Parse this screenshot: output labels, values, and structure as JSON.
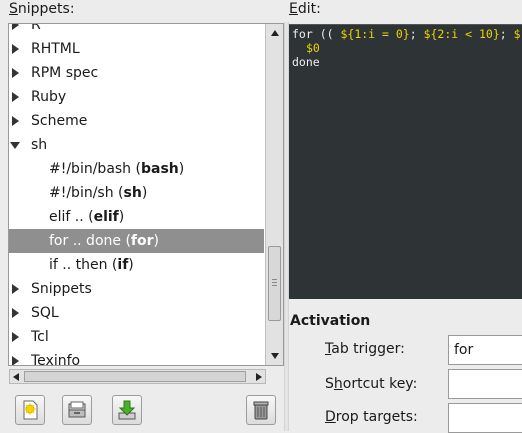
{
  "labels": {
    "snippets_first": "S",
    "snippets_rest": "nippets:",
    "edit_first": "E",
    "edit_rest": "dit:"
  },
  "tree": [
    {
      "label": "R",
      "expanded": false,
      "child": false
    },
    {
      "label": "RHTML",
      "expanded": false,
      "child": false
    },
    {
      "label": "RPM spec",
      "expanded": false,
      "child": false
    },
    {
      "label": "Ruby",
      "expanded": false,
      "child": false
    },
    {
      "label": "Scheme",
      "expanded": false,
      "child": false
    },
    {
      "label": "sh",
      "expanded": true,
      "child": false
    },
    {
      "label": "#!/bin/bash (",
      "trigger": "bash",
      "child": true
    },
    {
      "label": "#!/bin/sh (",
      "trigger": "sh",
      "child": true
    },
    {
      "label": "elif .. (",
      "trigger": "elif",
      "child": true
    },
    {
      "label": "for .. done (",
      "trigger": "for",
      "child": true,
      "selected": true
    },
    {
      "label": "if .. then (",
      "trigger": "if",
      "child": true
    },
    {
      "label": "Snippets",
      "expanded": false,
      "child": false
    },
    {
      "label": "SQL",
      "expanded": false,
      "child": false
    },
    {
      "label": "Tcl",
      "expanded": false,
      "child": false
    },
    {
      "label": "Texinfo",
      "expanded": false,
      "child": false
    }
  ],
  "editor": {
    "line1_a": "for (( ",
    "line1_ph1": "${1:i = 0}",
    "line1_b": "; ",
    "line1_ph2": "${2:i < 10}",
    "line1_c": "; ",
    "line1_ph3": "$",
    "line2": "$0",
    "line3": "done"
  },
  "activation": {
    "title": "Activation",
    "tab_trigger_first": "T",
    "tab_trigger_rest": "ab trigger:",
    "tab_trigger_value": "for",
    "shortcut_first": "h",
    "shortcut_pre": "S",
    "shortcut_rest": "ortcut key:",
    "shortcut_value": "",
    "drop_first": "D",
    "drop_rest": "rop targets:",
    "drop_value": ""
  },
  "toolbar": {
    "icons": [
      "new-snippet-icon",
      "import-icon",
      "export-icon",
      "trash-icon"
    ]
  },
  "colors": {
    "editor_bg": "#2e3436",
    "placeholder": "#edd400",
    "selection": "#8f8f8f"
  }
}
